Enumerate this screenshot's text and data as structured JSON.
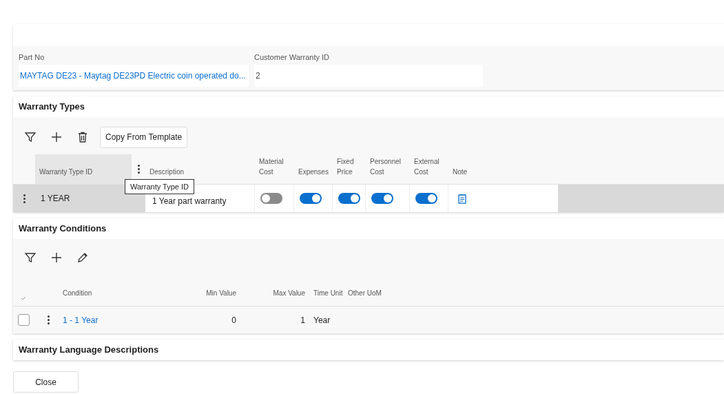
{
  "header": {
    "fields": [
      {
        "label": "Part No",
        "value": "MAYTAG DE23 - Maytag DE23PD Electric coin operated do...",
        "kind": "link"
      },
      {
        "label": "Customer Warranty ID",
        "value": "2",
        "kind": "text"
      }
    ]
  },
  "warranty_types": {
    "title": "Warranty Types",
    "copy_button": "Copy From Template",
    "columns": [
      "Warranty Type ID",
      "Description",
      "Material Cost",
      "Expenses",
      "Fixed Price",
      "Personnel Cost",
      "External Cost",
      "Note"
    ],
    "tooltip": "Warranty Type ID",
    "rows": [
      {
        "id": "1 YEAR",
        "description": "1 Year part warranty",
        "selected": true,
        "material_cost": false,
        "expenses": true,
        "fixed_price": true,
        "personnel_cost": true,
        "external_cost": true
      }
    ]
  },
  "warranty_conditions": {
    "title": "Warranty Conditions",
    "columns": [
      "Condition",
      "Min Value",
      "Max Value",
      "Time Unit",
      "Other UoM"
    ],
    "rows": [
      {
        "checked": false,
        "condition": "1 - 1 Year",
        "min_value": "0",
        "max_value": "1",
        "time_unit": "Year"
      }
    ]
  },
  "language_descriptions": {
    "title": "Warranty Language Descriptions"
  },
  "close_button": "Close"
}
